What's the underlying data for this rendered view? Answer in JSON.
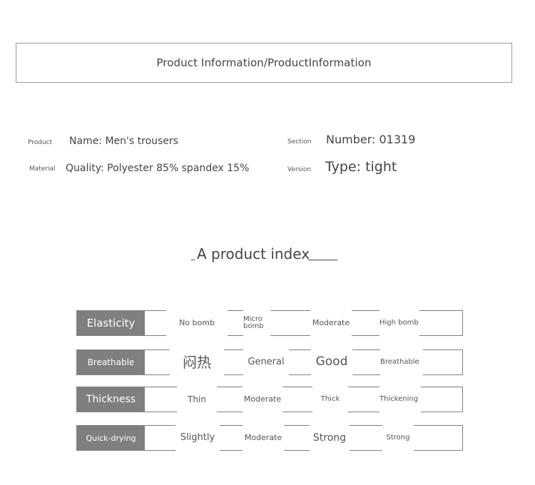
{
  "header": {
    "title": "Product Information/ProductInformation"
  },
  "info": {
    "product_label": "Product",
    "product_value": "Name: Men's trousers",
    "section_label": "Section",
    "section_value": "Number: 01319",
    "material_label": "Material",
    "material_value": "Quality: Polyester 85% spandex 15%",
    "version_label": "Version",
    "version_value": "Type: tight"
  },
  "index": {
    "heading": "A product index",
    "rows": [
      {
        "label": "Elasticity",
        "cells": [
          "No bomb",
          "Micro bomb",
          "Moderate",
          "High bomb"
        ]
      },
      {
        "label": "Breathable",
        "cells": [
          "闷热",
          "General",
          "Good",
          "Breathable"
        ]
      },
      {
        "label": "Thickness",
        "cells": [
          "Thin",
          "Moderate",
          "Thick",
          "Thickening"
        ]
      },
      {
        "label": "Quick-drying",
        "cells": [
          "Slightly",
          "Moderate",
          "Strong",
          "Strong"
        ]
      }
    ]
  }
}
